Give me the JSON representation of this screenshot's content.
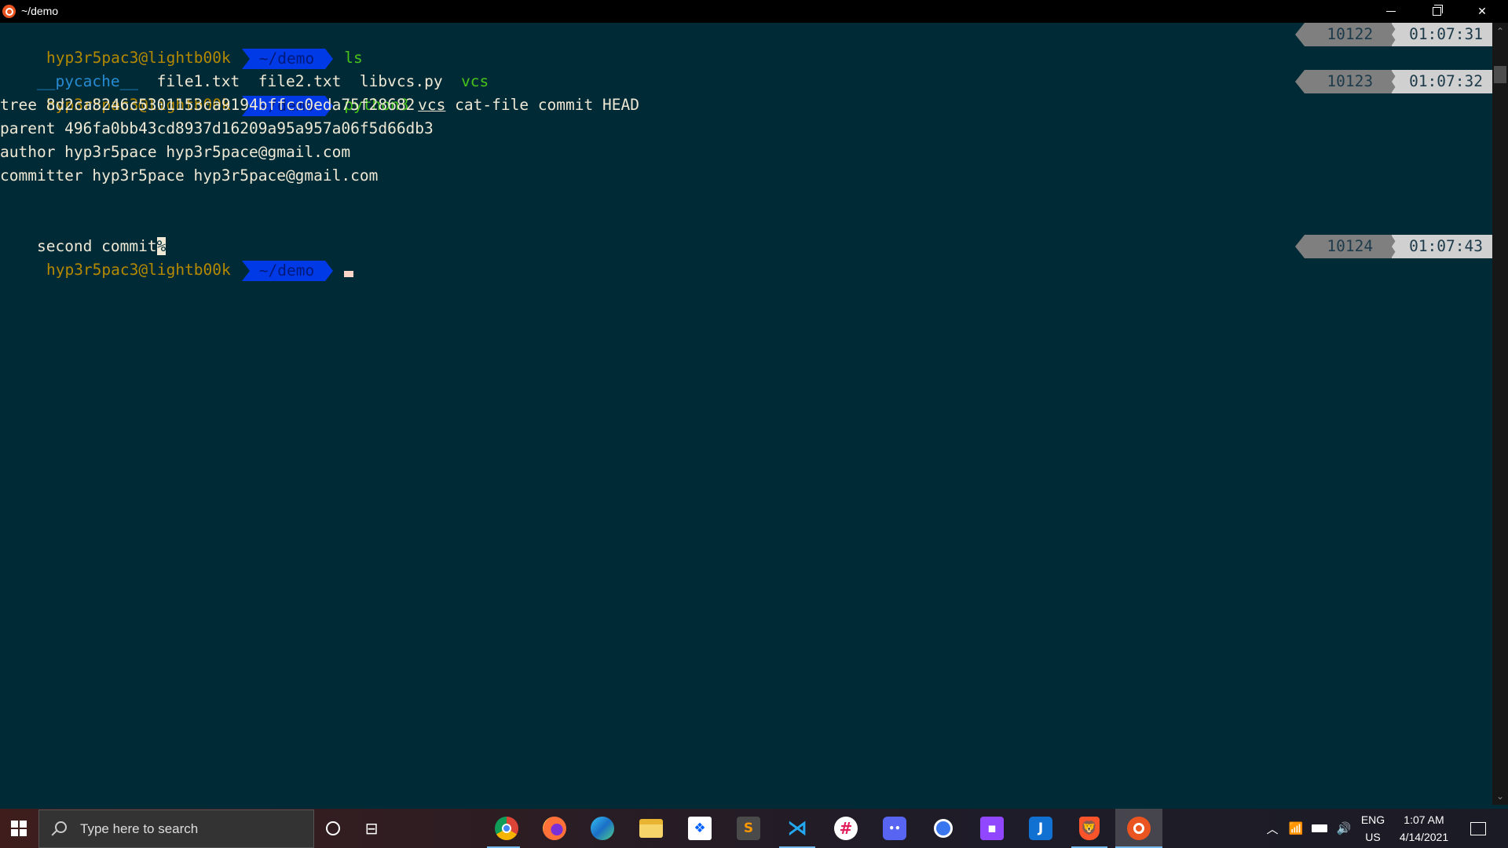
{
  "window": {
    "title": "~/demo",
    "icon": "ubuntu-icon",
    "controls": {
      "minimize": "minimize",
      "maximize": "restore",
      "close": "close"
    }
  },
  "terminal": {
    "prompt": {
      "user_host": "hyp3r5pac3@lightb00k",
      "path": "~/demo"
    },
    "lines": [
      {
        "type": "prompt",
        "command": "ls",
        "history": "10122",
        "time": "01:07:31"
      },
      {
        "type": "output",
        "items": [
          {
            "text": "__pycache__",
            "kind": "directory"
          },
          {
            "text": "file1.txt",
            "kind": "file"
          },
          {
            "text": "file2.txt",
            "kind": "file"
          },
          {
            "text": "libvcs.py",
            "kind": "file"
          },
          {
            "text": "vcs",
            "kind": "executable"
          }
        ]
      },
      {
        "type": "prompt",
        "command_prog": "python3",
        "command_arg1": "vcs",
        "command_rest": "cat-file commit HEAD",
        "history": "10123",
        "time": "01:07:32"
      },
      {
        "type": "output",
        "text": "tree 8d2ca8246c5301153ca9194bffcc0eda75f28682"
      },
      {
        "type": "output",
        "text": "parent 496fa0bb43cd8937d16209a95a957a06f5d66db3"
      },
      {
        "type": "output",
        "text": "author hyp3r5pace hyp3r5pace@gmail.com"
      },
      {
        "type": "output",
        "text": "committer hyp3r5pace hyp3r5pace@gmail.com"
      },
      {
        "type": "output",
        "text": ""
      },
      {
        "type": "output",
        "text": "second commit",
        "no_newline_marker": "%"
      },
      {
        "type": "prompt",
        "command": "",
        "history": "10124",
        "time": "01:07:43"
      }
    ],
    "colors": {
      "background": "#002b36",
      "user": "#b58900",
      "path_bg": "#0039e6",
      "command": "#46c21a",
      "directory": "#268bd2"
    }
  },
  "taskbar": {
    "search_placeholder": "Type here to search",
    "apps": [
      {
        "name": "chrome",
        "active": false,
        "running": true
      },
      {
        "name": "firefox",
        "active": false,
        "running": false
      },
      {
        "name": "edge",
        "active": false,
        "running": false
      },
      {
        "name": "file-explorer",
        "active": false,
        "running": false
      },
      {
        "name": "dropbox",
        "active": false,
        "running": false
      },
      {
        "name": "sublime-text",
        "active": false,
        "running": false
      },
      {
        "name": "vscode",
        "active": false,
        "running": true
      },
      {
        "name": "slack",
        "active": false,
        "running": false
      },
      {
        "name": "discord",
        "active": false,
        "running": false
      },
      {
        "name": "signal",
        "active": false,
        "running": false
      },
      {
        "name": "twitch",
        "active": false,
        "running": false
      },
      {
        "name": "joplin",
        "active": false,
        "running": false
      },
      {
        "name": "brave",
        "active": false,
        "running": true
      },
      {
        "name": "ubuntu",
        "active": true,
        "running": true
      }
    ],
    "tray": {
      "language": "ENG",
      "region": "US",
      "time": "1:07 AM",
      "date": "4/14/2021"
    }
  }
}
